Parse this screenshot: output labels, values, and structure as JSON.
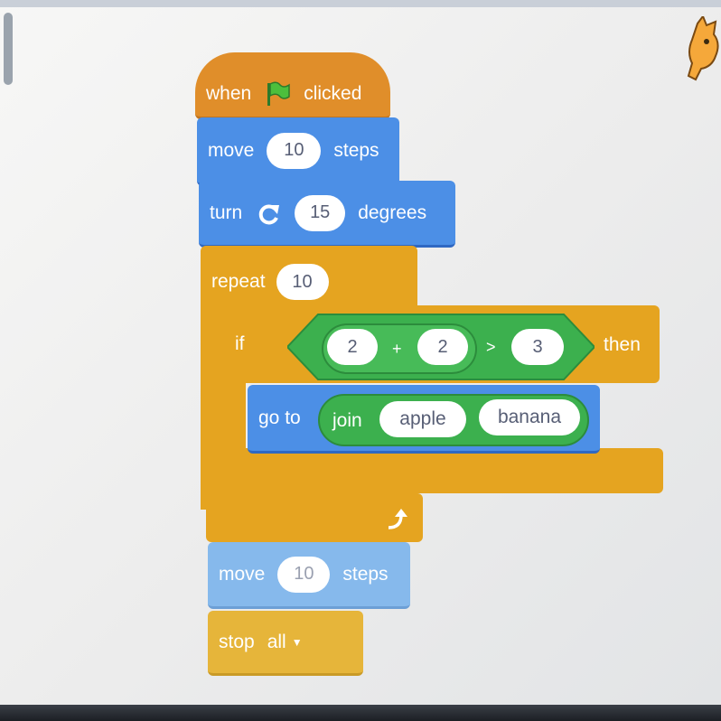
{
  "hat": {
    "when": "when",
    "clicked": "clicked"
  },
  "move1": {
    "label": "move",
    "value": "10",
    "unit": "steps"
  },
  "turn": {
    "label": "turn",
    "value": "15",
    "unit": "degrees"
  },
  "repeat": {
    "label": "repeat",
    "value": "10"
  },
  "if_block": {
    "if_label": "if",
    "then_label": "then",
    "left": "2",
    "plus": "+",
    "right": "2",
    "gt": ">",
    "compare": "3"
  },
  "goto": {
    "label": "go to",
    "join_label": "join",
    "arg1": "apple",
    "arg2": "banana"
  },
  "move2": {
    "label": "move",
    "value": "10",
    "unit": "steps"
  },
  "stop": {
    "label": "stop",
    "value": "all",
    "arrow": "▼"
  },
  "colors": {
    "events": "#e08e2a",
    "motion": "#4c8fe6",
    "control": "#e5a420",
    "operators": "#3cb04e"
  }
}
